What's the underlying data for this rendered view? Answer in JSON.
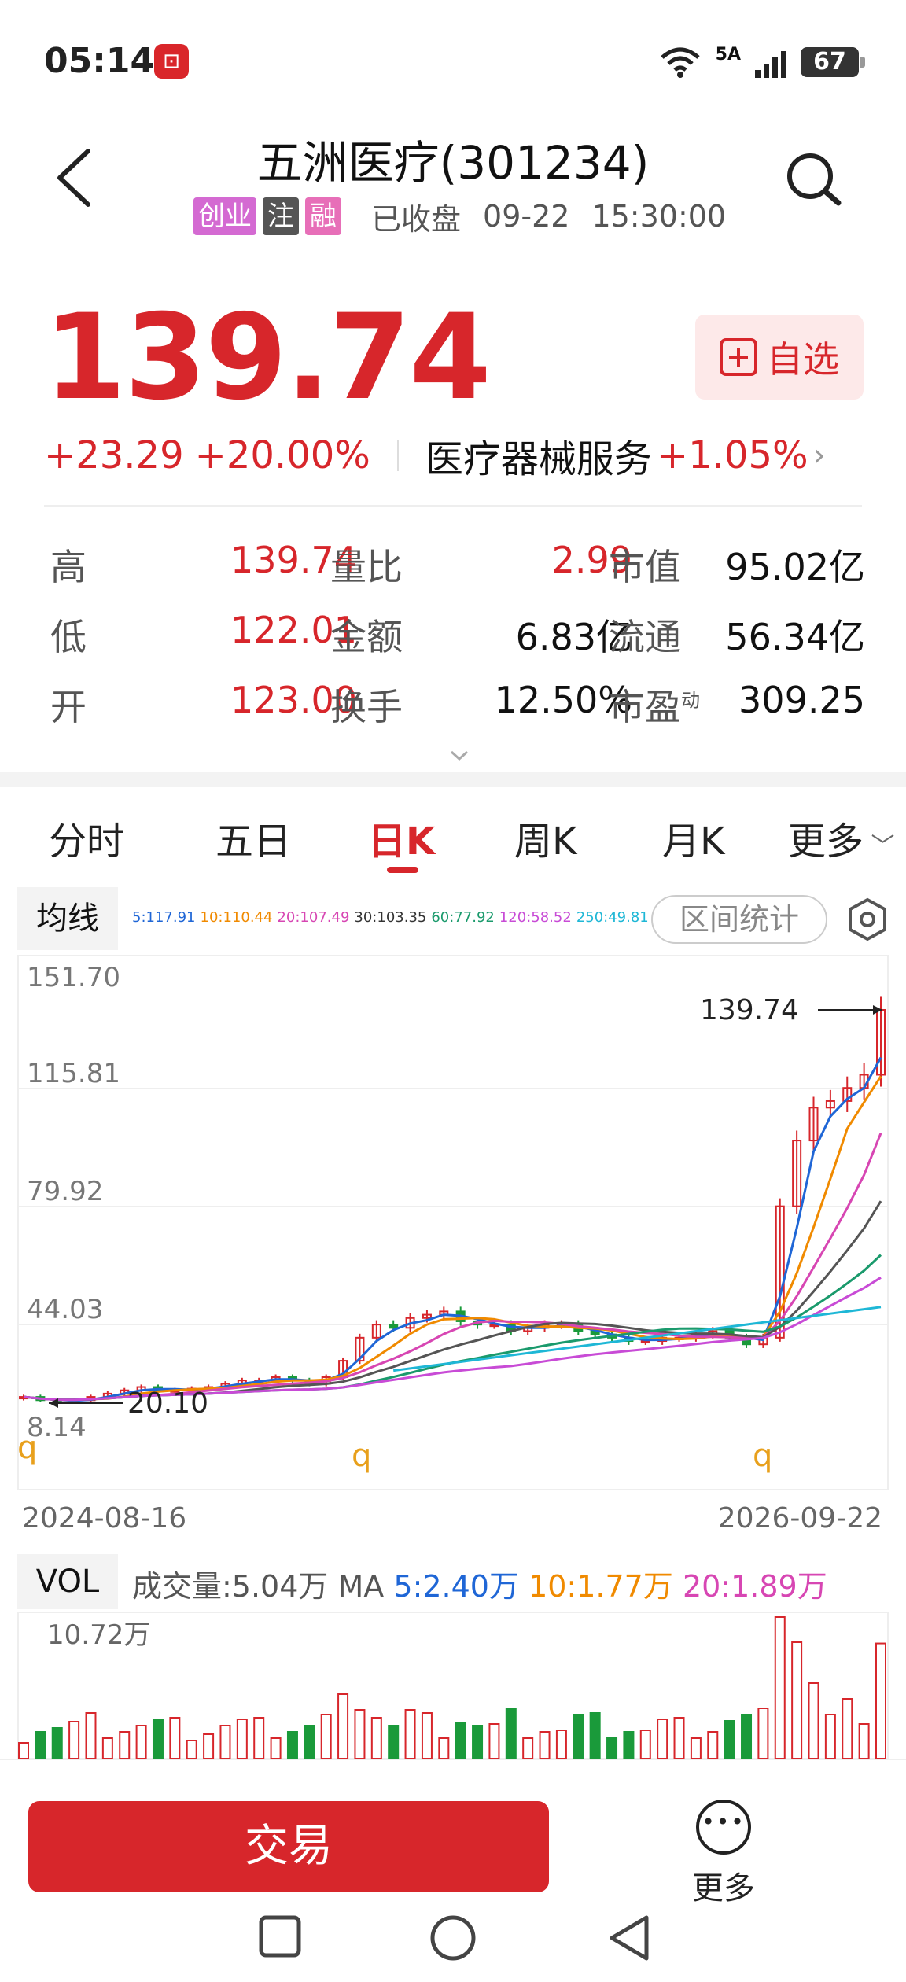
{
  "status_bar": {
    "time": "05:14",
    "app_icon_text": "⊡",
    "net_label": "5A",
    "battery": "67"
  },
  "header": {
    "title": "五洲医疗(301234)",
    "tags": [
      "创业",
      "注",
      "融"
    ],
    "status": "已收盘",
    "date": "09-22",
    "time": "15:30:00"
  },
  "quote": {
    "price": "139.74",
    "change": "+23.29",
    "change_pct": "+20.00%",
    "sector": "医疗器械服务",
    "sector_pct": "+1.05%",
    "watch_label": "自选"
  },
  "stats": [
    {
      "l1": "高",
      "v1": "139.74",
      "l2": "量比",
      "v2": "2.99",
      "l3": "市值",
      "v3": "95.02亿"
    },
    {
      "l1": "低",
      "v1": "122.01",
      "l2": "金额",
      "v2": "6.83亿",
      "l3": "流通",
      "v3": "56.34亿"
    },
    {
      "l1": "开",
      "v1": "123.00",
      "l2": "换手",
      "v2": "12.50%",
      "l3": "市盈",
      "l3_sup": "动",
      "v3": "309.25"
    }
  ],
  "tabs": [
    "分时",
    "五日",
    "日K",
    "周K",
    "月K",
    "更多"
  ],
  "ma": {
    "label": "均线",
    "values": [
      {
        "text": "5:117.91",
        "color": "#1f66d6"
      },
      {
        "text": "10:110.44",
        "color": "#f08a00"
      },
      {
        "text": "20:107.49",
        "color": "#d746b3"
      },
      {
        "text": "30:103.35",
        "color": "#333333"
      },
      {
        "text": "60:77.92",
        "color": "#1a9a6c"
      },
      {
        "text": "120:58.52",
        "color": "#c84bd6"
      },
      {
        "text": "250:49.81",
        "color": "#1eb7d6"
      }
    ],
    "range_label": "区间统计"
  },
  "chart_labels": {
    "y_ticks": [
      "151.70",
      "115.81",
      "79.92",
      "44.03",
      "8.14"
    ],
    "last_price_label": "139.74",
    "low_label": "20.10",
    "marker": "q",
    "date_start": "2024-08-16",
    "date_end": "2026-09-22"
  },
  "chart_data": {
    "type": "candlestick",
    "ylim": [
      8.14,
      151.7
    ],
    "y_ticks": [
      151.7,
      115.81,
      79.92,
      44.03,
      8.14
    ],
    "x_range": [
      "2024-08-16",
      "2026-09-22"
    ],
    "last_close": 139.74,
    "annotated_low": 20.1,
    "close_series": [
      22,
      21,
      20.5,
      21,
      22,
      23,
      24,
      25,
      24,
      24,
      24.5,
      25,
      26,
      27,
      27,
      28,
      27,
      26,
      28,
      33,
      40,
      44,
      43,
      46,
      47,
      48,
      45,
      44,
      44,
      42,
      43,
      44,
      44,
      42,
      41,
      40,
      39,
      39,
      40,
      40,
      41,
      42,
      40,
      38,
      40,
      80,
      100,
      110,
      112,
      116,
      120,
      139.74
    ]
  },
  "vol": {
    "label": "VOL",
    "volume": "成交量:5.04万",
    "ma_label": "MA",
    "ma5": "5:2.40万",
    "ma10": "10:1.77万",
    "ma20": "20:1.89万",
    "max_label": "10.72万"
  },
  "bottom": {
    "trade_label": "交易",
    "more_label": "更多"
  },
  "colors": {
    "up": "#d7262b",
    "down": "#1a9a3a",
    "ma5": "#1f66d6",
    "ma10": "#f08a00",
    "ma20": "#d746b3"
  }
}
